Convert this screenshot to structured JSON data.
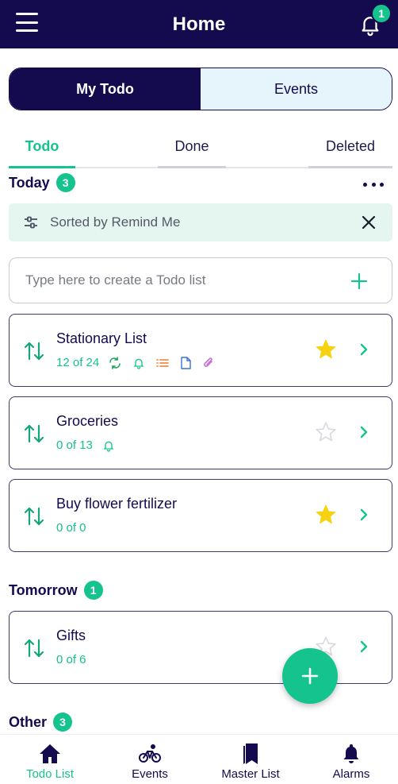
{
  "header": {
    "title": "Home",
    "notification_count": "1"
  },
  "segment": {
    "active": "My Todo",
    "inactive": "Events"
  },
  "tabs": [
    {
      "label": "Todo"
    },
    {
      "label": "Done"
    },
    {
      "label": "Deleted"
    }
  ],
  "sections": {
    "today": {
      "label": "Today",
      "count": "3"
    },
    "tomorrow": {
      "label": "Tomorrow",
      "count": "1"
    },
    "other": {
      "label": "Other",
      "count": "3"
    }
  },
  "sort_bar": {
    "text": "Sorted by Remind Me"
  },
  "create": {
    "placeholder": "Type here to create a Todo list"
  },
  "lists": [
    {
      "name": "Stationary List",
      "progress": "12 of 24",
      "starred": true
    },
    {
      "name": "Groceries",
      "progress": "0 of 13",
      "starred": false
    },
    {
      "name": "Buy flower fertilizer",
      "progress": "0 of 0",
      "starred": true
    },
    {
      "name": "Gifts",
      "progress": "0 of 6",
      "starred": false
    }
  ],
  "bottom_nav": [
    {
      "label": "Todo List",
      "icon": "home-icon"
    },
    {
      "label": "Events",
      "icon": "bicycle-icon"
    },
    {
      "label": "Master List",
      "icon": "bookmark-icon"
    },
    {
      "label": "Alarms",
      "icon": "bell-icon"
    }
  ],
  "colors": {
    "navy": "#140a4e",
    "accent": "#14c38e",
    "star": "#f5d312",
    "light_blue": "#e6f4fb",
    "sort_bg": "#e4f6ef"
  }
}
